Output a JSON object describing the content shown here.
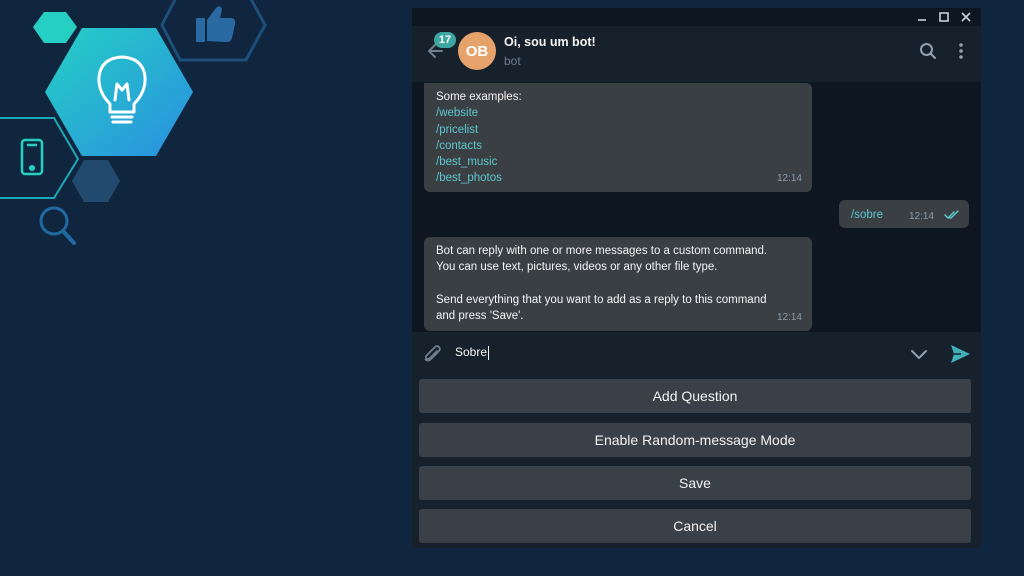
{
  "chat": {
    "unread_count": "17",
    "avatar_initials": "OB",
    "title": "Oi, sou um bot!",
    "subtitle": "bot"
  },
  "messages": [
    {
      "direction": "in",
      "intro": "Some examples:",
      "commands": [
        "/website",
        "/pricelist",
        "/contacts",
        "/best_music",
        "/best_photos"
      ],
      "time": "12:14"
    },
    {
      "direction": "out",
      "text": "/sobre",
      "time": "12:14",
      "status_icon": "double-check-icon"
    },
    {
      "direction": "in",
      "lines": [
        "Bot can reply with one or more messages to a custom command.",
        "You can use text, pictures, videos or any other file type.",
        "",
        "Send everything that you want to add as a reply to this command",
        "and press 'Save'."
      ],
      "time": "12:14"
    }
  ],
  "composer": {
    "value": "Sobre"
  },
  "keyboard": {
    "buttons": [
      "Add Question",
      "Enable Random-message Mode",
      "Save",
      "Cancel"
    ]
  },
  "icons": {
    "decor": [
      "hexagon",
      "thumbs-up-icon",
      "lightbulb-icon",
      "smartphone-icon",
      "search-icon"
    ],
    "header": [
      "back-arrow-icon",
      "search-icon",
      "more-vertical-icon"
    ],
    "composer": [
      "paperclip-icon",
      "chevron-down-icon",
      "send-icon"
    ],
    "window": [
      "minimize-icon",
      "maximize-icon",
      "close-icon"
    ]
  },
  "colors": {
    "background": "#10263f",
    "accent": "#5bc8cd",
    "badge": "#3ea6a2",
    "avatar": "#e6a26b",
    "button": "#3a4047"
  }
}
